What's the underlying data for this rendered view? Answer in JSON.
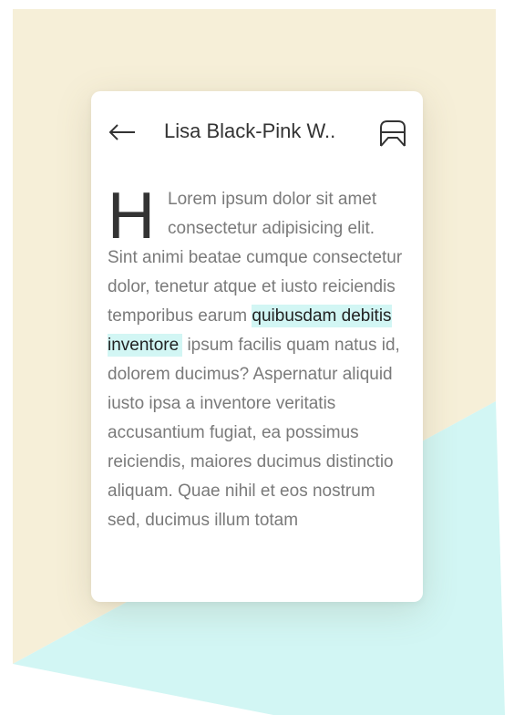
{
  "colors": {
    "cream": "#f6efd8",
    "mint": "#d2f6f4",
    "card": "#ffffff",
    "title_text": "#333333",
    "body_text": "#7a7a7a",
    "highlight_text": "#222222"
  },
  "header": {
    "back_icon": "arrow-left-icon",
    "title": "Lisa Black-Pink W..",
    "bookmark_icon": "bookmark-icon"
  },
  "article": {
    "drop_cap": "H",
    "text_before": "Lorem ipsum dolor sit amet consectetur adipisicing elit. Sint animi beatae cumque consectetur dolor, tenetur atque et iusto reiciendis temporibus earum ",
    "highlighted": "quibusdam debitis inventore",
    "text_after": " ipsum facilis quam natus id, dolorem ducimus? Aspernatur aliquid iusto ipsa a inventore veritatis accusantium fugiat, ea possimus reiciendis, maiores ducimus distinctio aliquam. Quae nihil et eos nostrum sed, ducimus illum totam"
  }
}
